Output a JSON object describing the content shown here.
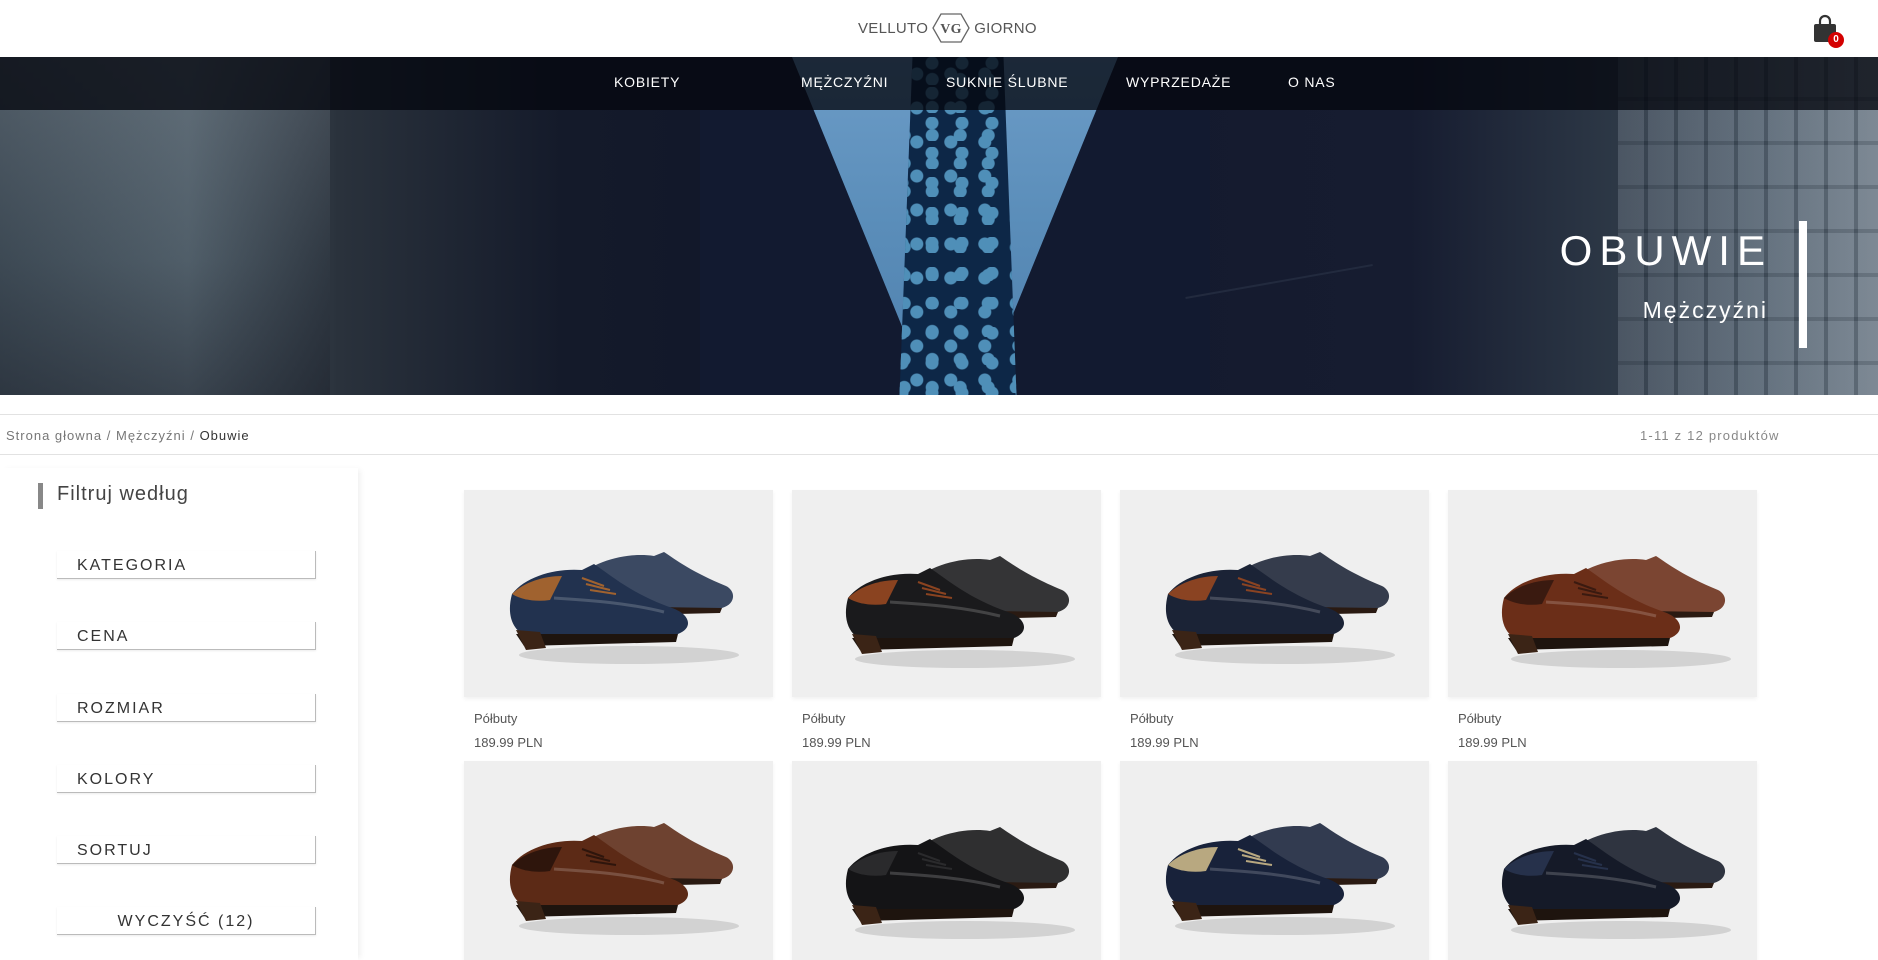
{
  "header": {
    "logo_left": "VELLUTO",
    "logo_mark": "VG",
    "logo_right": "GIORNO",
    "cart_count": "0",
    "cart_icon": "shopping-bag-icon"
  },
  "nav": {
    "items": [
      {
        "label": "KOBIETY"
      },
      {
        "label": "MĘŻCZYŹNI"
      },
      {
        "label": "SUKNIE ŚLUBNE"
      },
      {
        "label": "WYPRZEDAŻE"
      },
      {
        "label": "O NAS"
      }
    ]
  },
  "hero": {
    "title": "OBUWIE",
    "subtitle": "Mężczyźni"
  },
  "breadcrumb": {
    "home": "Strona głowna",
    "category": "Mężczyźni",
    "current": "Obuwie",
    "separator": "/"
  },
  "results_count": "1-11 z 12 produktów",
  "sidebar": {
    "heading": "Filtruj według",
    "filters": [
      {
        "label": "KATEGORIA"
      },
      {
        "label": "CENA"
      },
      {
        "label": "ROZMIAR"
      },
      {
        "label": "KOLORY"
      },
      {
        "label": "SORTUJ"
      }
    ],
    "clear_label": "WYCZYŚĆ (12)"
  },
  "products": [
    {
      "name": "Półbuty",
      "price": "189.99 PLN",
      "color": "#22324f",
      "accent": "#a0622f"
    },
    {
      "name": "Półbuty",
      "price": "189.99 PLN",
      "color": "#1a1a1c",
      "accent": "#8a4320"
    },
    {
      "name": "Półbuty",
      "price": "189.99 PLN",
      "color": "#1b2336",
      "accent": "#8a4322"
    },
    {
      "name": "Półbuty",
      "price": "189.99 PLN",
      "color": "#6b2e18",
      "accent": "#3a1a10"
    },
    {
      "name": "",
      "price": "",
      "color": "#5c2a16",
      "accent": "#2e150c"
    },
    {
      "name": "",
      "price": "",
      "color": "#141416",
      "accent": "#2a2a2c"
    },
    {
      "name": "",
      "price": "",
      "color": "#18223a",
      "accent": "#b8a880"
    },
    {
      "name": "",
      "price": "",
      "color": "#151a28",
      "accent": "#26314b"
    }
  ]
}
